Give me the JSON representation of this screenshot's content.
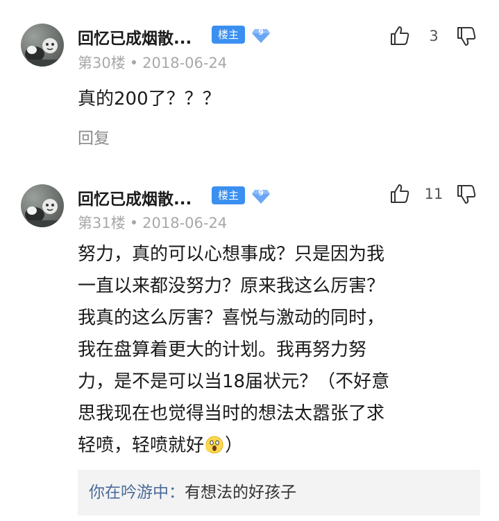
{
  "posts": [
    {
      "author": "回忆已成烟散...",
      "badge": "楼主",
      "level": "9",
      "floor": "第30楼",
      "separator": "•",
      "date": "2018-06-24",
      "likes": "3",
      "content": "真的200了？？？",
      "reply_label": "回复"
    },
    {
      "author": "回忆已成烟散...",
      "badge": "楼主",
      "level": "9",
      "floor": "第31楼",
      "separator": "•",
      "date": "2018-06-24",
      "likes": "11",
      "content_lines": [
        "努力，真的可以心想事成？只是因为我",
        "一直以来都没努力？原来我这么厉害？",
        "我真的这么厉害？喜悦与激动的同时，",
        "我在盘算着更大的计划。我再努力努",
        "力，是不是可以当18届状元？（不好意",
        "思我现在也觉得当时的想法太嚣张了求",
        "轻喷，轻喷就好"
      ],
      "content_tail": "）",
      "sub_reply": {
        "author": "你在吟游中",
        "colon": "：",
        "text": "有想法的好孩子"
      }
    }
  ],
  "icons": {
    "like": "thumbs-up-icon",
    "dislike": "thumbs-down-icon",
    "level": "diamond-level-icon",
    "emoji": "screaming-face-emoji"
  },
  "colors": {
    "badge": "#3a8ff0",
    "level": "#6aa6f5",
    "sub_reply_author": "#4a6a9a",
    "meta": "#a8a8a8"
  }
}
